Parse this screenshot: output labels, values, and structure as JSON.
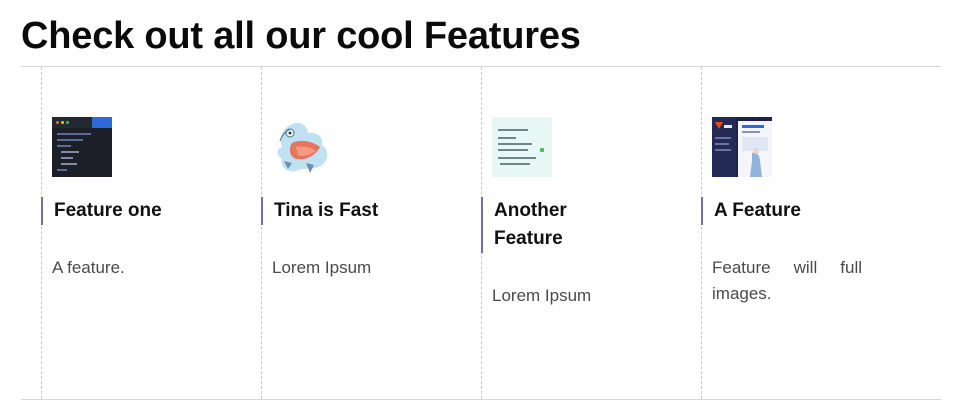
{
  "page": {
    "title": "Check out all our cool Features"
  },
  "features": [
    {
      "title": "Feature one",
      "description": "A feature.",
      "image": "code-editor-thumbnail"
    },
    {
      "title": "Tina is Fast",
      "description": "Lorem Ipsum",
      "image": "llama-illustration-thumbnail"
    },
    {
      "title": "Another Feature",
      "description": "Lorem Ipsum",
      "image": "terminal-thumbnail"
    },
    {
      "title": "A Feature",
      "description": "Feature will full images.",
      "image": "webpage-thumbnail"
    }
  ],
  "colors": {
    "title_accent": "#6f71a6",
    "divider": "#d7d7d7",
    "description_text": "#4a4a4a"
  }
}
